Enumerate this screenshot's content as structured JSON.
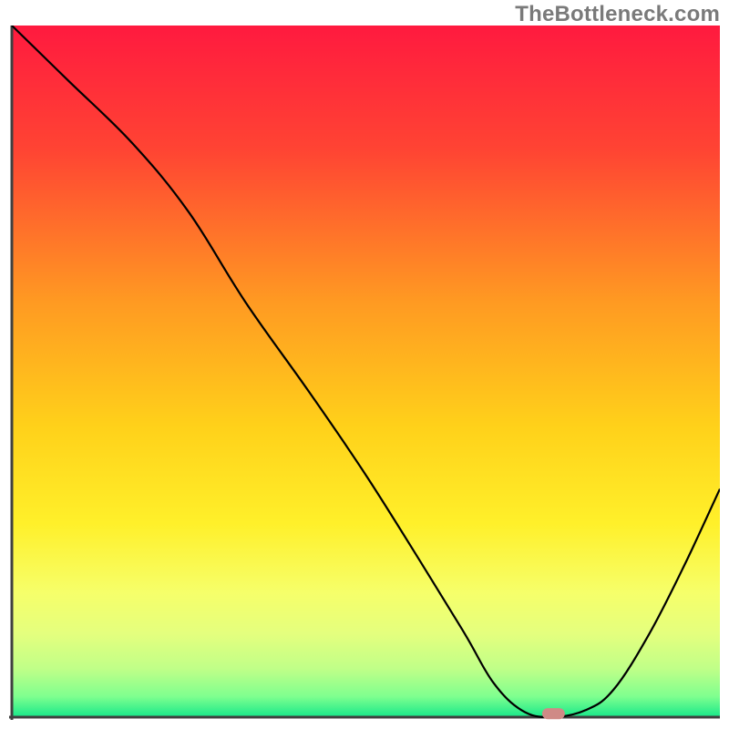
{
  "watermark": "TheBottleneck.com",
  "chart_data": {
    "type": "line",
    "title": "",
    "xlabel": "",
    "ylabel": "",
    "xlim": [
      0,
      100
    ],
    "ylim": [
      0,
      100
    ],
    "grid": false,
    "series": [
      {
        "name": "bottleneck-curve",
        "color": "#000000",
        "x": [
          0,
          8,
          17,
          25,
          33,
          42,
          50,
          58,
          64,
          68,
          72,
          76,
          81,
          85,
          90,
          95,
          100
        ],
        "values": [
          100,
          92,
          83,
          73,
          60,
          47,
          35,
          22,
          12,
          5,
          1,
          0,
          1,
          4,
          12,
          22,
          33
        ]
      }
    ],
    "marker": {
      "x": 76.5,
      "y": 0.5,
      "width": 3.2,
      "height": 1.6,
      "color": "#cf8a86"
    },
    "gradient_stops": [
      {
        "offset": 0.0,
        "color": "#ff1a3f"
      },
      {
        "offset": 0.18,
        "color": "#ff4433"
      },
      {
        "offset": 0.4,
        "color": "#ff9a22"
      },
      {
        "offset": 0.58,
        "color": "#ffd11a"
      },
      {
        "offset": 0.72,
        "color": "#fff02a"
      },
      {
        "offset": 0.82,
        "color": "#f6ff6a"
      },
      {
        "offset": 0.88,
        "color": "#e4ff7e"
      },
      {
        "offset": 0.93,
        "color": "#c0ff88"
      },
      {
        "offset": 0.97,
        "color": "#7fff8f"
      },
      {
        "offset": 1.0,
        "color": "#17e88a"
      }
    ],
    "axes_color": "#404040"
  }
}
